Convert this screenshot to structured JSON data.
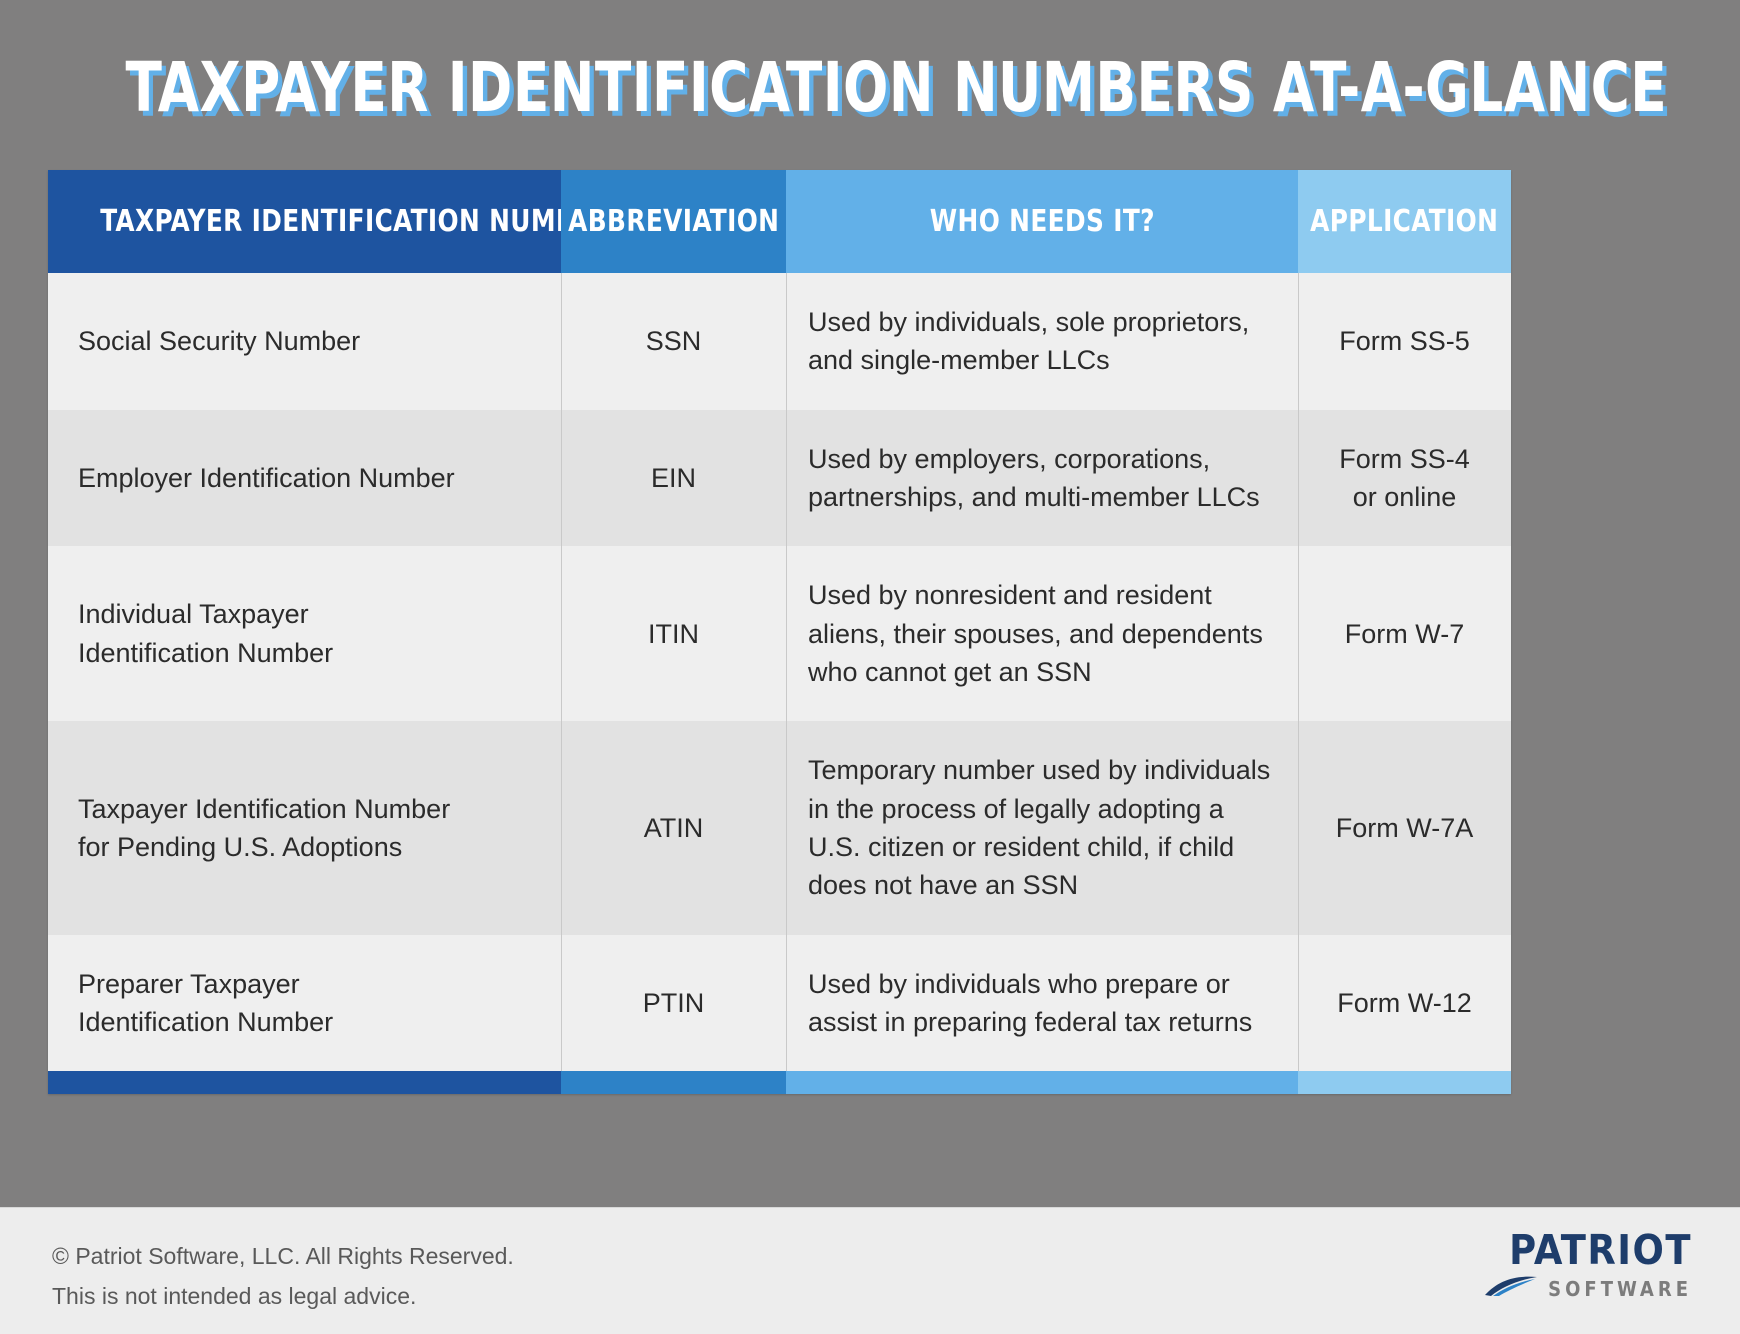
{
  "page": {
    "title": "TAXPAYER IDENTIFICATION NUMBERS AT-A-GLANCE",
    "background_color": "#807f7f"
  },
  "colors": {
    "col1": "#1e54a0",
    "col2": "#2d82c7",
    "col3": "#62b0e8",
    "col4": "#8ecbf0",
    "row_odd": "#efefef",
    "row_even": "#e2e2e2",
    "title_shadow": "#62b0e8",
    "logo_navy": "#1e3d6b",
    "logo_gray": "#7c7c7c"
  },
  "table": {
    "headers": [
      {
        "label": "TAXPAYER IDENTIFICATION NUMBER"
      },
      {
        "label": "ABBREVIATION"
      },
      {
        "label": "WHO NEEDS IT?"
      },
      {
        "label": "APPLICATION"
      }
    ],
    "rows": [
      {
        "name": [
          "Social Security Number"
        ],
        "abbreviation": "SSN",
        "who_needs_it": [
          "Used by individuals, sole proprietors,",
          "and single-member LLCs"
        ],
        "application": [
          "Form SS-5"
        ]
      },
      {
        "name": [
          "Employer Identification Number"
        ],
        "abbreviation": "EIN",
        "who_needs_it": [
          "Used by employers, corporations,",
          "partnerships, and multi-member LLCs"
        ],
        "application": [
          "Form SS-4",
          "or online"
        ]
      },
      {
        "name": [
          "Individual Taxpayer",
          "Identification Number"
        ],
        "abbreviation": "ITIN",
        "who_needs_it": [
          "Used by nonresident and resident",
          "aliens, their spouses, and dependents",
          "who cannot get an SSN"
        ],
        "application": [
          "Form W-7"
        ]
      },
      {
        "name": [
          "Taxpayer Identification Number",
          "for Pending U.S. Adoptions"
        ],
        "abbreviation": "ATIN",
        "who_needs_it": [
          "Temporary number used by individuals",
          "in the process of legally adopting a",
          "U.S. citizen or resident child, if child",
          "does not have an SSN"
        ],
        "application": [
          "Form W-7A"
        ]
      },
      {
        "name": [
          "Preparer Taxpayer",
          "Identification Number"
        ],
        "abbreviation": "PTIN",
        "who_needs_it": [
          "Used by individuals who prepare or",
          "assist in preparing federal tax returns"
        ],
        "application": [
          "Form W-12"
        ]
      }
    ]
  },
  "footer": {
    "line1": "© Patriot Software, LLC. All Rights Reserved.",
    "line2": "This is not intended as legal advice.",
    "logo": {
      "wordmark": "PATRIOT",
      "subtext": "SOFTWARE",
      "icon": "swoosh-icon"
    }
  }
}
